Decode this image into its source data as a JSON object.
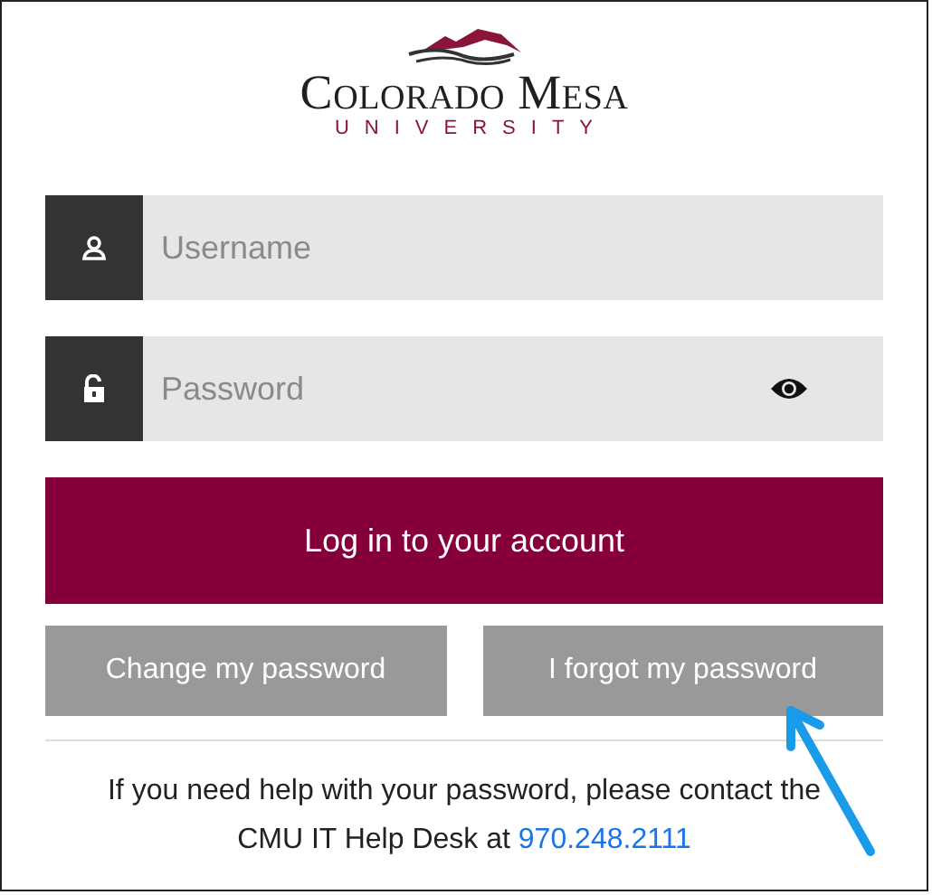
{
  "logo": {
    "name": "Colorado Mesa",
    "subtitle": "UNIVERSITY"
  },
  "fields": [
    {
      "kind": "user",
      "placeholder": "Username"
    },
    {
      "kind": "password",
      "placeholder": "Password"
    }
  ],
  "login_button": "Log in to your account",
  "secondary_buttons": [
    "Change my password",
    "I forgot my password"
  ],
  "help": {
    "text": "If you need help with your password, please contact the CMU IT Help Desk at",
    "phone": "970.248.2111"
  }
}
